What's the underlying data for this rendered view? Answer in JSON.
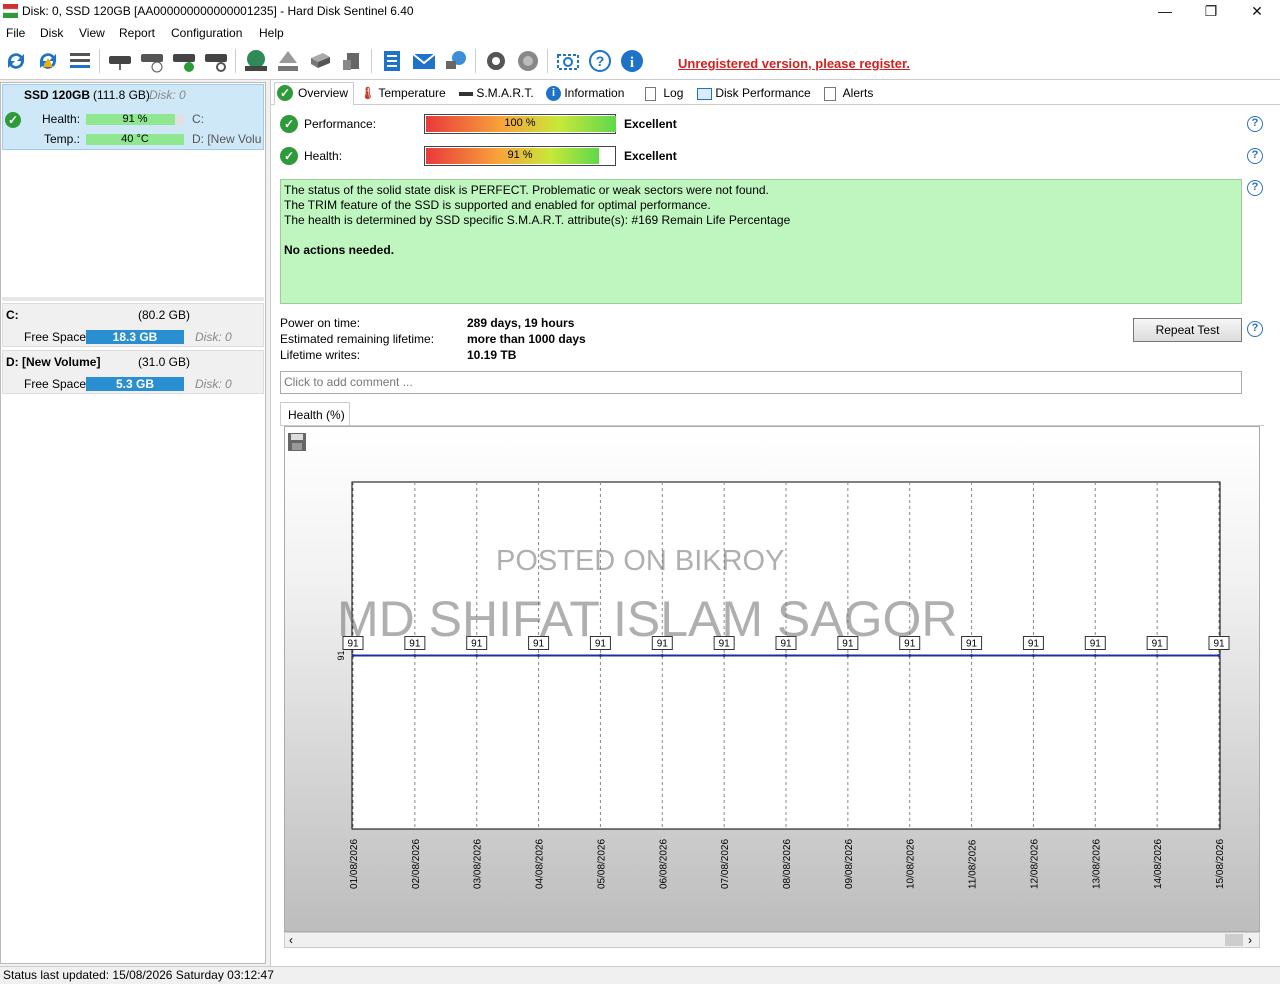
{
  "window": {
    "title": "Disk: 0, SSD 120GB [AA000000000000001235]  -  Hard Disk Sentinel 6.40",
    "minimize_glyph": "—",
    "restore_glyph": "❐",
    "close_glyph": "✕"
  },
  "menu": [
    "File",
    "Disk",
    "View",
    "Report",
    "Configuration",
    "Help"
  ],
  "toolbar": {
    "icons": [
      "refresh-icon",
      "refresh-alert-icon",
      "disk-list-icon",
      "disk-icon",
      "disk-time-icon",
      "disk-check-icon",
      "disk-search-icon",
      "globe-icon",
      "upload-icon",
      "drive-icon",
      "drive-alt-icon",
      "notes-icon",
      "mail-icon",
      "network-icon",
      "settings-icon",
      "sound-icon",
      "screenshot-icon",
      "help-icon",
      "info-icon"
    ],
    "register_text": "Unregistered version, please register."
  },
  "disk": {
    "name": "SSD 120GB",
    "size": "(111.8 GB)",
    "index": "Disk: 0",
    "health_label": "Health:",
    "health_value": "91 %",
    "health_pct": 91,
    "temp_label": "Temp.:",
    "temp_value": "40 °C",
    "temp_pct": 100,
    "part_c": "C:",
    "part_d": "D: [New Volu"
  },
  "volumes": [
    {
      "name": "C:",
      "size": "(80.2 GB)",
      "free_label": "Free Space",
      "free": "18.3 GB",
      "free_pct": 100,
      "disk": "Disk: 0"
    },
    {
      "name": "D: [New Volume]",
      "size": "(31.0 GB)",
      "free_label": "Free Space",
      "free": "5.3 GB",
      "free_pct": 100,
      "disk": "Disk: 0"
    }
  ],
  "tabs": [
    "Overview",
    "Temperature",
    "S.M.A.R.T.",
    "Information",
    "Log",
    "Disk Performance",
    "Alerts"
  ],
  "overview": {
    "performance_label": "Performance:",
    "performance_value": "100 %",
    "performance_pct": 100,
    "performance_rating": "Excellent",
    "health_label": "Health:",
    "health_value": "91 %",
    "health_pct": 91,
    "health_rating": "Excellent",
    "status_lines": [
      "The status of the solid state disk is PERFECT. Problematic or weak sectors were not found.",
      "The TRIM feature of the SSD is supported and enabled for optimal performance.",
      "The health is determined by SSD specific S.M.A.R.T. attribute(s):  #169 Remain Life Percentage"
    ],
    "status_action": "No actions needed.",
    "power_on_label": "Power on time:",
    "power_on_value": "289 days, 19 hours",
    "remaining_label": "Estimated remaining lifetime:",
    "remaining_value": "more than 1000 days",
    "writes_label": "Lifetime writes:",
    "writes_value": "10.19 TB",
    "repeat_button": "Repeat Test",
    "comment_placeholder": "Click to add comment ...",
    "graph_tab": "Health (%)"
  },
  "watermark": {
    "line1": "POSTED ON BIKROY",
    "line2": "MD SHIFAT ISLAM SAGOR"
  },
  "chart_data": {
    "type": "line",
    "x": [
      "01/08/2026",
      "02/08/2026",
      "03/08/2026",
      "04/08/2026",
      "05/08/2026",
      "06/08/2026",
      "07/08/2026",
      "08/08/2026",
      "09/08/2026",
      "10/08/2026",
      "11/08/2026",
      "12/08/2026",
      "13/08/2026",
      "14/08/2026",
      "15/08/2026"
    ],
    "series": [
      {
        "values": [
          91,
          91,
          91,
          91,
          91,
          91,
          91,
          91,
          91,
          91,
          91,
          91,
          91,
          91,
          91
        ]
      }
    ],
    "y_tick": "91",
    "line_color": "#1f2fa0"
  },
  "statusbar": "Status last updated: 15/08/2026 Saturday 03:12:47"
}
